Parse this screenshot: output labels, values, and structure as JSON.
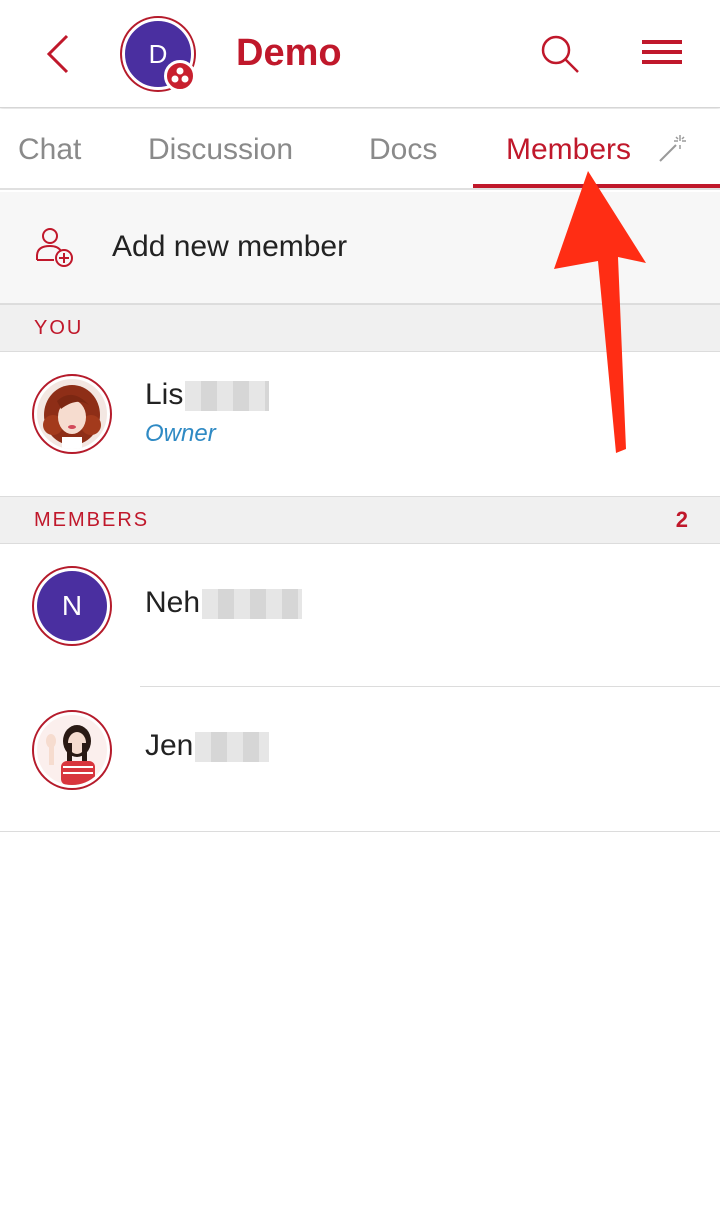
{
  "header": {
    "back_icon": "chevron-left-icon",
    "group_initial": "D",
    "title": "Demo",
    "search_icon": "search-icon",
    "menu_icon": "hamburger-menu-icon",
    "accent_color": "#c0182b"
  },
  "tabs": [
    {
      "label": "Chat",
      "active": false
    },
    {
      "label": "Discussion",
      "active": false
    },
    {
      "label": "Docs",
      "active": false
    },
    {
      "label": "Members",
      "active": true
    }
  ],
  "tabs_extra_icon": "magic-wand-icon",
  "add_member": {
    "icon": "add-user-icon",
    "label": "Add new member"
  },
  "you_section": {
    "label": "YOU",
    "members": [
      {
        "name": "Lis",
        "role": "Owner"
      }
    ]
  },
  "members_section": {
    "label": "MEMBERS",
    "count": "2",
    "members": [
      {
        "initial": "N",
        "name": "Neh"
      },
      {
        "name": "Jen"
      }
    ]
  }
}
